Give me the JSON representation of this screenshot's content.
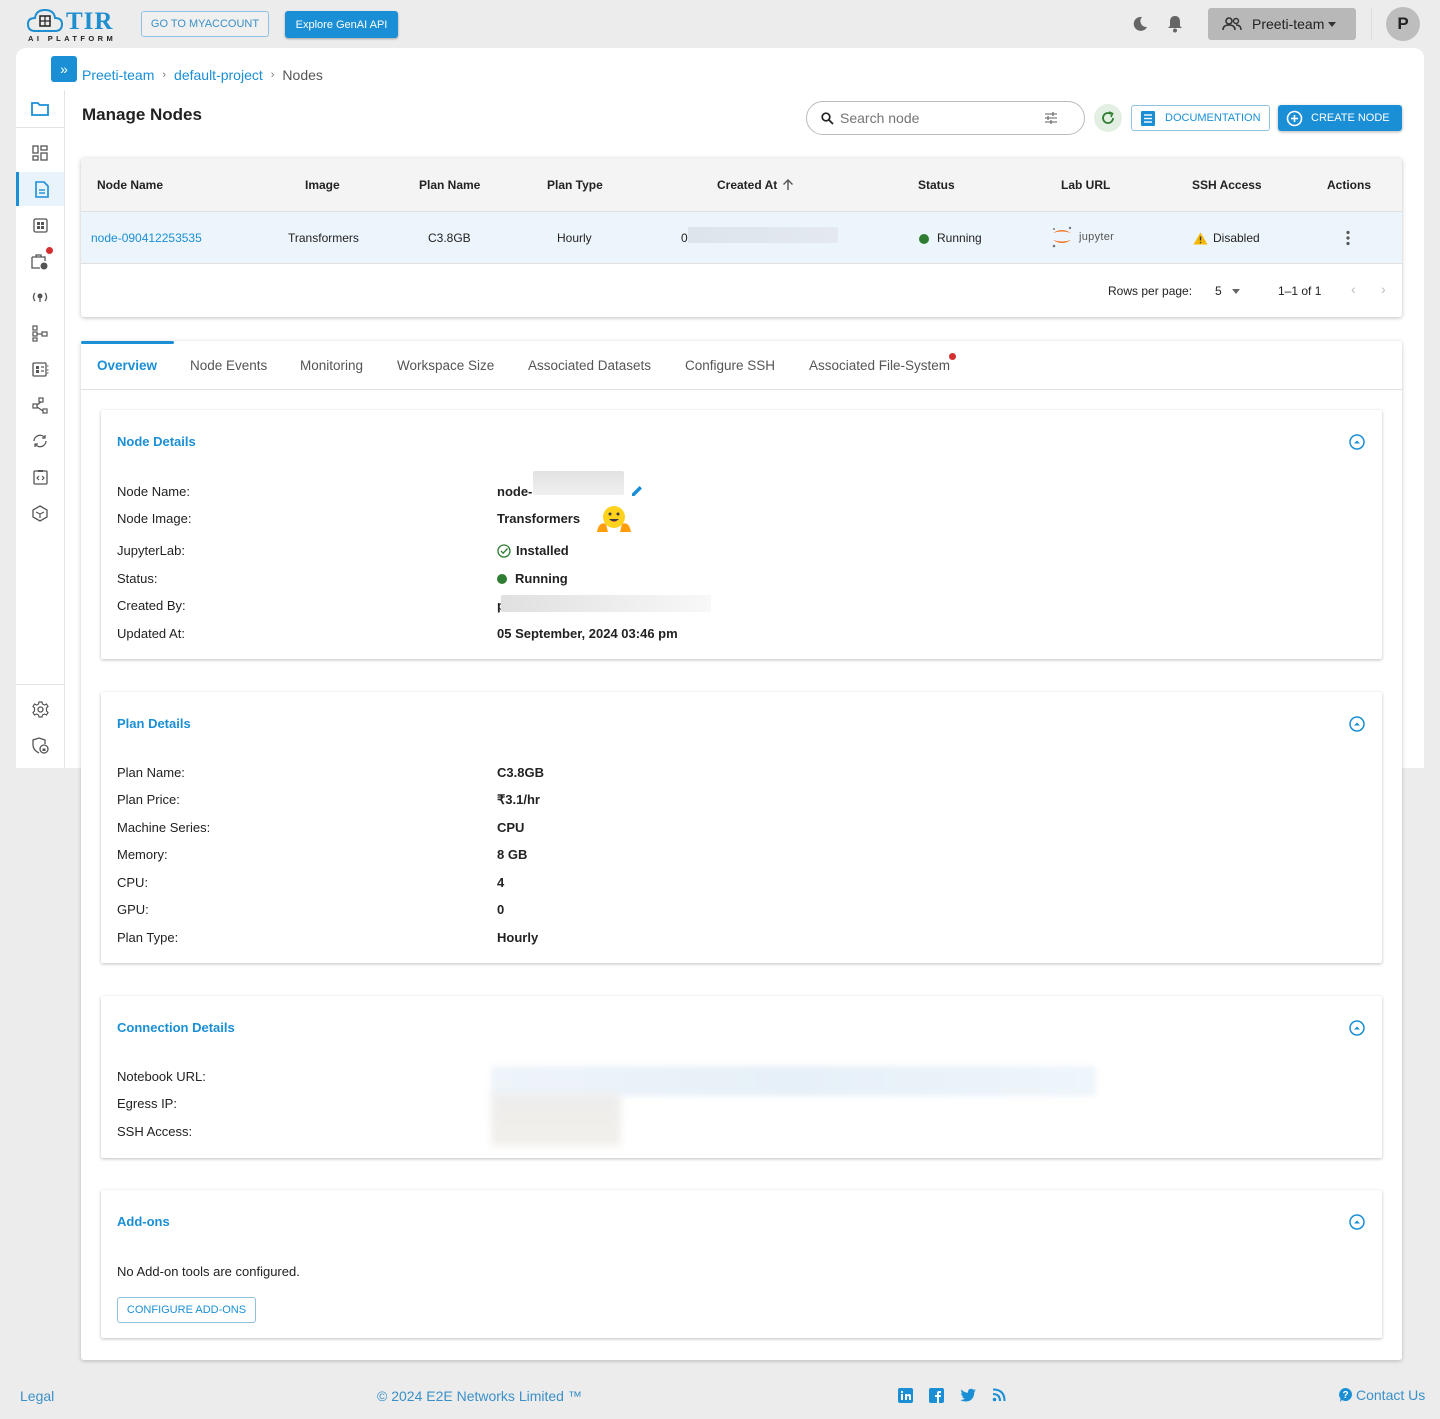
{
  "header": {
    "logo_title": "TIR",
    "logo_subtitle": "AI PLATFORM",
    "myaccount_label": "GO TO MYACCOUNT",
    "genai_label": "Explore GenAI API",
    "team_name": "Preeti-team",
    "avatar_initial": "P"
  },
  "breadcrumb": [
    "Preeti-team",
    "default-project",
    "Nodes"
  ],
  "page": {
    "title": "Manage Nodes",
    "search_placeholder": "Search node",
    "documentation_label": "DOCUMENTATION",
    "create_label": "CREATE NODE"
  },
  "table": {
    "columns": [
      "Node Name",
      "Image",
      "Plan Name",
      "Plan Type",
      "Created At",
      "Status",
      "Lab URL",
      "SSH Access",
      "Actions"
    ],
    "rows": [
      {
        "node_name": "node-090412253535",
        "image": "Transformers",
        "plan_name": "C3.8GB",
        "plan_type": "Hourly",
        "created_at": "0",
        "status": "Running",
        "lab_url": "jupyter",
        "ssh_access": "Disabled"
      }
    ],
    "rows_per_page_label": "Rows per page:",
    "rows_per_page": "5",
    "pagination": "1–1 of 1"
  },
  "tabs": [
    "Overview",
    "Node Events",
    "Monitoring",
    "Workspace Size",
    "Associated Datasets",
    "Configure SSH",
    "Associated File-System"
  ],
  "node_details": {
    "title": "Node Details",
    "items": [
      {
        "label": "Node Name:",
        "value": "node-"
      },
      {
        "label": "Node Image:",
        "value": "Transformers"
      },
      {
        "label": "JupyterLab:",
        "value": "Installed"
      },
      {
        "label": "Status:",
        "value": "Running"
      },
      {
        "label": "Created By:",
        "value": "p"
      },
      {
        "label": "Updated At:",
        "value": "05 September, 2024 03:46 pm"
      }
    ]
  },
  "plan_details": {
    "title": "Plan Details",
    "items": [
      {
        "label": "Plan Name:",
        "value": "C3.8GB"
      },
      {
        "label": "Plan Price:",
        "value": "₹3.1/hr"
      },
      {
        "label": "Machine Series:",
        "value": "CPU"
      },
      {
        "label": "Memory:",
        "value": "8 GB"
      },
      {
        "label": "CPU:",
        "value": "4"
      },
      {
        "label": "GPU:",
        "value": "0"
      },
      {
        "label": "Plan Type:",
        "value": "Hourly"
      }
    ]
  },
  "connection_details": {
    "title": "Connection Details",
    "items": [
      {
        "label": "Notebook URL:"
      },
      {
        "label": "Egress IP:"
      },
      {
        "label": "SSH Access:"
      }
    ]
  },
  "addons": {
    "title": "Add-ons",
    "empty_text": "No Add-on tools are configured.",
    "configure_label": "CONFIGURE ADD-ONS"
  },
  "footer": {
    "legal": "Legal",
    "copyright": "© 2024 E2E Networks Limited ™",
    "contact": "Contact Us"
  },
  "colors": {
    "accent": "#1a8fd6",
    "running": "#2e7d32",
    "warning": "#f5b800",
    "badge": "#d32f2f"
  }
}
